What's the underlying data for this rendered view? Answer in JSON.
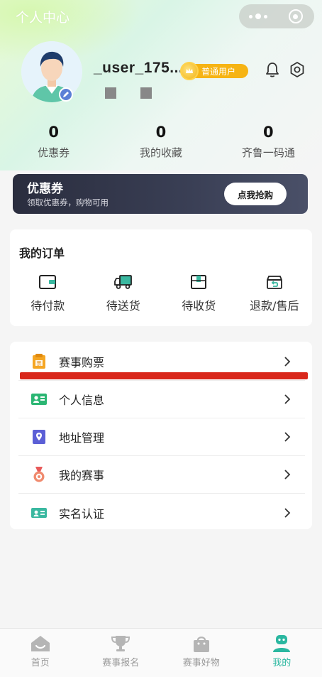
{
  "nav": {
    "title": "个人中心"
  },
  "profile": {
    "username": "_user_175...",
    "member_level": "普通用户"
  },
  "stats": [
    {
      "value": "0",
      "label": "优惠券"
    },
    {
      "value": "0",
      "label": "我的收藏"
    },
    {
      "value": "0",
      "label": "齐鲁一码通"
    }
  ],
  "coupon": {
    "title": "优惠券",
    "subtitle": "领取优惠券，购物可用",
    "button": "点我抢购"
  },
  "orders": {
    "title": "我的订单",
    "items": [
      {
        "label": "待付款",
        "icon": "wallet-icon"
      },
      {
        "label": "待送货",
        "icon": "truck-icon"
      },
      {
        "label": "待收货",
        "icon": "package-icon"
      },
      {
        "label": "退款/售后",
        "icon": "refund-icon"
      }
    ]
  },
  "menu": [
    {
      "label": "赛事购票",
      "icon": "ticket-icon"
    },
    {
      "label": "个人信息",
      "icon": "id-card-icon"
    },
    {
      "label": "地址管理",
      "icon": "location-icon"
    },
    {
      "label": "我的赛事",
      "icon": "medal-icon"
    },
    {
      "label": "实名认证",
      "icon": "verify-card-icon"
    }
  ],
  "tabbar": [
    {
      "label": "首页",
      "icon": "home-icon",
      "active": false
    },
    {
      "label": "赛事报名",
      "icon": "trophy-icon",
      "active": false
    },
    {
      "label": "赛事好物",
      "icon": "shopping-bag-icon",
      "active": false
    },
    {
      "label": "我的",
      "icon": "user-icon",
      "active": true
    }
  ],
  "colors": {
    "accent": "#2ab7a0",
    "member_badge": "#f6b414",
    "coupon_bg": "#2a2d3e",
    "highlight_line": "#d9271b"
  }
}
